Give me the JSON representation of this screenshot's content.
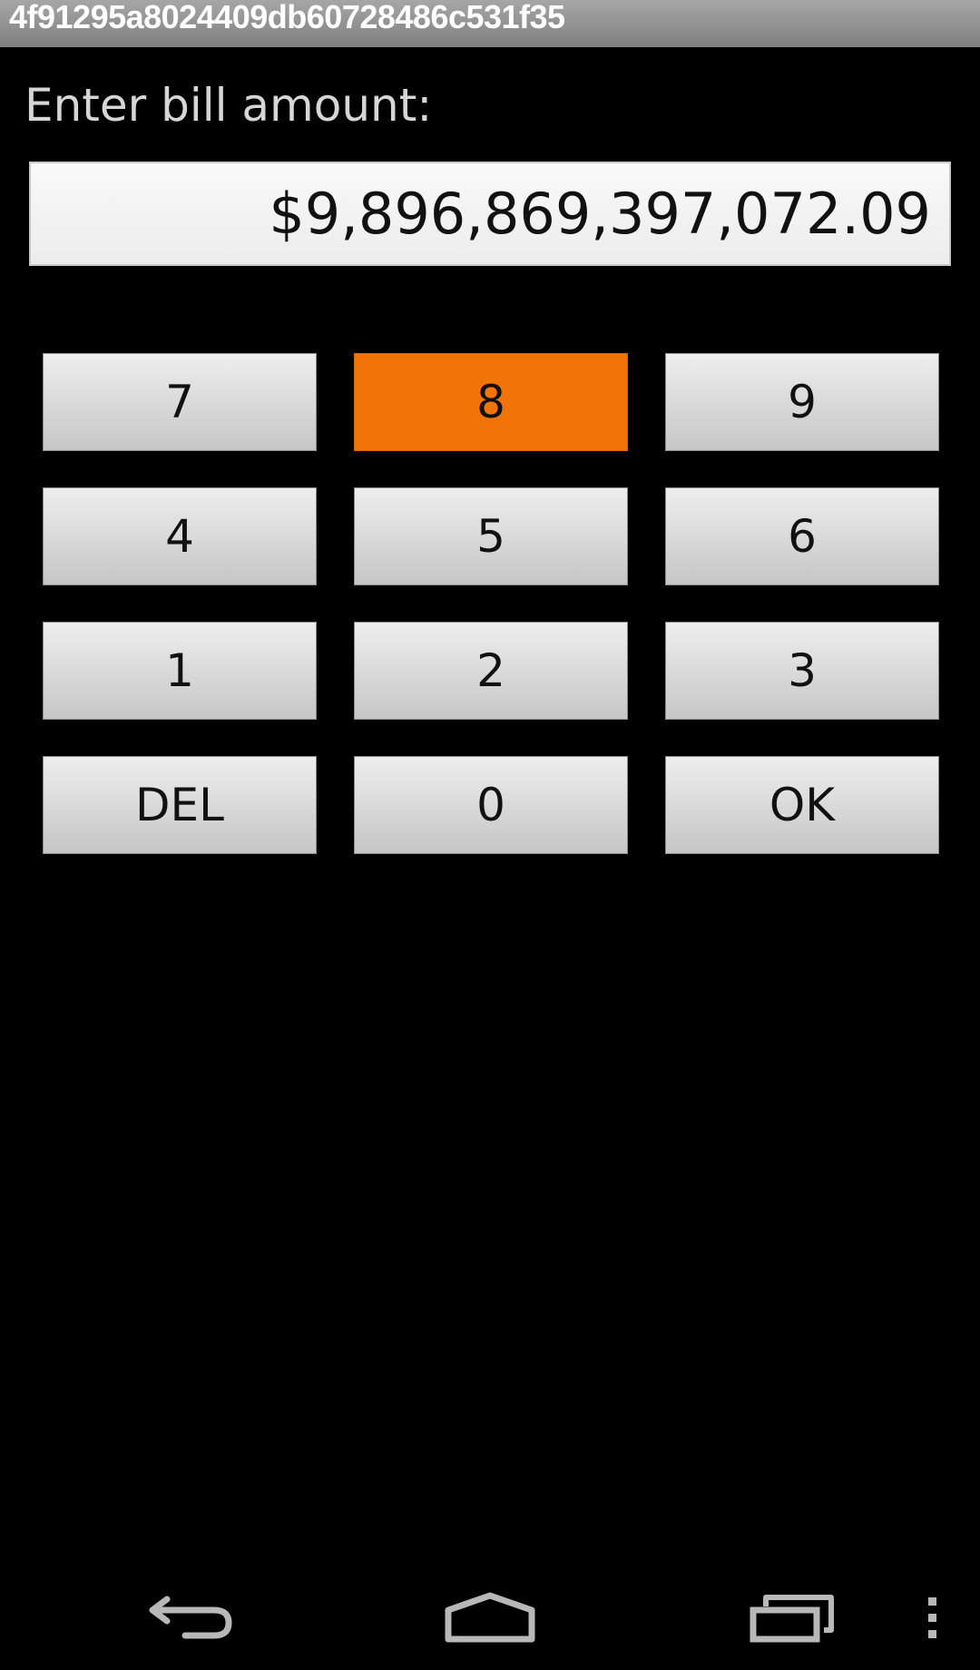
{
  "window": {
    "title": "4f91295a8024409db60728486c531f35"
  },
  "form": {
    "prompt": "Enter bill amount:",
    "amount_value": "$9,896,869,397,072.09"
  },
  "keypad": {
    "rows": [
      [
        {
          "label": "7"
        },
        {
          "label": "8",
          "pressed": true
        },
        {
          "label": "9"
        }
      ],
      [
        {
          "label": "4"
        },
        {
          "label": "5"
        },
        {
          "label": "6"
        }
      ],
      [
        {
          "label": "1"
        },
        {
          "label": "2"
        },
        {
          "label": "3"
        }
      ],
      [
        {
          "label": "DEL"
        },
        {
          "label": "0"
        },
        {
          "label": "OK"
        }
      ]
    ]
  },
  "navbar": {
    "icons": [
      "back-icon",
      "home-icon",
      "recent-apps-icon",
      "overflow-menu-icon"
    ]
  },
  "colors": {
    "pressed_key": "#f07408",
    "background": "#000000"
  }
}
